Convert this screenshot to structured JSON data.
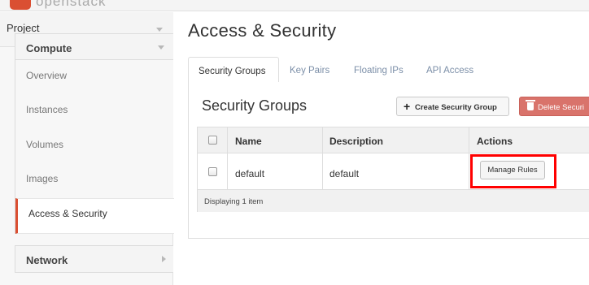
{
  "app": {
    "logo_text": "openstack"
  },
  "sidebar": {
    "project_label": "Project",
    "compute_label": "Compute",
    "items": [
      {
        "label": "Overview"
      },
      {
        "label": "Instances"
      },
      {
        "label": "Volumes"
      },
      {
        "label": "Images"
      },
      {
        "label": "Access & Security",
        "active": true
      }
    ],
    "network_label": "Network"
  },
  "main": {
    "page_title": "Access & Security",
    "tabs": [
      {
        "label": "Security Groups",
        "active": true
      },
      {
        "label": "Key Pairs"
      },
      {
        "label": "Floating IPs"
      },
      {
        "label": "API Access"
      }
    ],
    "section_title": "Security Groups",
    "create_button": "Create Security Group",
    "delete_button": "Delete Securi",
    "table": {
      "headers": {
        "name": "Name",
        "description": "Description",
        "actions": "Actions"
      },
      "rows": [
        {
          "name": "default",
          "description": "default",
          "action": "Manage Rules"
        }
      ],
      "footer": "Displaying 1 item"
    }
  },
  "colors": {
    "accent": "#da4f32",
    "tab_link": "#7c8fa8",
    "danger_button": "#d9736b",
    "highlight": "#ff0000"
  },
  "icons": {
    "project_toggle": "chevron-down-icon",
    "compute_toggle": "chevron-down-icon",
    "network_toggle": "chevron-right-icon",
    "create": "plus-icon",
    "delete": "trash-icon"
  }
}
